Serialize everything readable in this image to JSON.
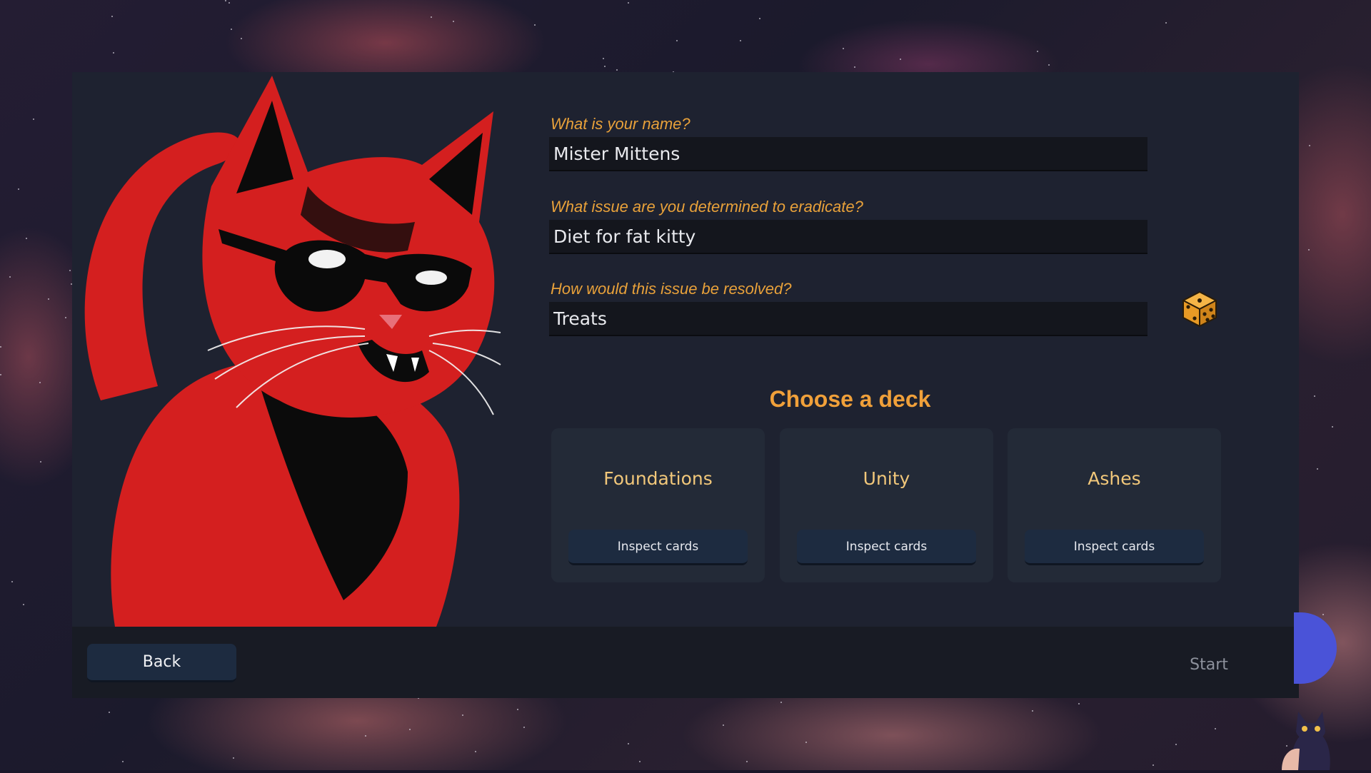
{
  "form": {
    "name_label": "What is your name?",
    "name_value": "Mister Mittens",
    "issue_label": "What issue are you determined to eradicate?",
    "issue_value": "Diet for fat kitty",
    "resolve_label": "How would this issue be resolved?",
    "resolve_value": "Treats",
    "randomize_icon": "dice-icon"
  },
  "deck_section": {
    "heading": "Choose a deck",
    "decks": [
      {
        "title": "Foundations",
        "button_label": "Inspect cards"
      },
      {
        "title": "Unity",
        "button_label": "Inspect cards"
      },
      {
        "title": "Ashes",
        "button_label": "Inspect cards"
      }
    ]
  },
  "footer": {
    "back_label": "Back",
    "start_label": "Start"
  },
  "colors": {
    "accent": "#f0a03a",
    "deck_title": "#f1c77a",
    "panel": "#1e2230",
    "button": "#1d2b40"
  },
  "art": {
    "icon": "cat-with-sunglasses-illustration"
  }
}
